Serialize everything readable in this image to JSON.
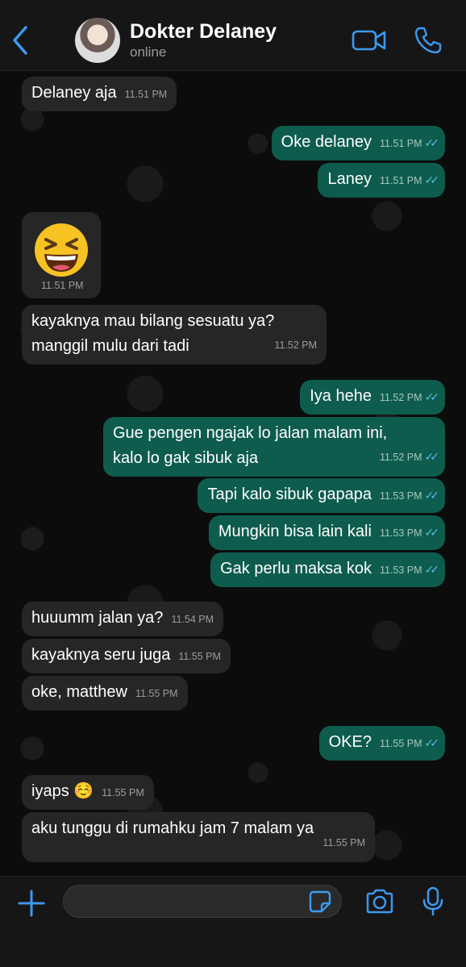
{
  "header": {
    "contact_name": "Dokter Delaney",
    "status": "online"
  },
  "messages": [
    {
      "dir": "in",
      "text": "Delaney aja",
      "time": "11.51 PM"
    },
    {
      "dir": "out",
      "text": "Oke delaney",
      "time": "11.51 PM",
      "read": true
    },
    {
      "dir": "out",
      "text": "Laney",
      "time": "11.51 PM",
      "read": true
    },
    {
      "dir": "in",
      "emoji": "laughing-squint-face",
      "time": "11.51 PM"
    },
    {
      "dir": "in",
      "lines": [
        "kayaknya mau bilang sesuatu ya?",
        "manggil mulu dari tadi"
      ],
      "time": "11.52 PM"
    },
    {
      "dir": "out",
      "text": "Iya hehe",
      "time": "11.52 PM",
      "read": true
    },
    {
      "dir": "out",
      "lines": [
        "Gue pengen ngajak lo jalan malam ini,",
        "kalo lo gak sibuk aja"
      ],
      "time": "11.52 PM",
      "read": true
    },
    {
      "dir": "out",
      "text": "Tapi kalo sibuk gapapa",
      "time": "11.53 PM",
      "read": true
    },
    {
      "dir": "out",
      "text": "Mungkin bisa lain kali",
      "time": "11.53 PM",
      "read": true
    },
    {
      "dir": "out",
      "text": "Gak perlu maksa kok",
      "time": "11.53 PM",
      "read": true
    },
    {
      "dir": "in",
      "text": "huuumm jalan ya?",
      "time": "11.54 PM"
    },
    {
      "dir": "in",
      "text": "kayaknya seru juga",
      "time": "11.55 PM"
    },
    {
      "dir": "in",
      "text": "oke, matthew",
      "time": "11.55 PM"
    },
    {
      "dir": "out",
      "text": "OKE?",
      "time": "11.55 PM",
      "read": true
    },
    {
      "dir": "in",
      "text": "iyaps ☺️",
      "time": "11.55 PM"
    },
    {
      "dir": "in",
      "text": "aku tunggu di rumahku jam 7 malam ya",
      "time": "11.55 PM"
    }
  ],
  "colors": {
    "accent": "#3b9af0",
    "outgoing_bubble": "#0e5c4d",
    "incoming_bubble": "#262626",
    "read_ticks": "#53bdeb"
  },
  "icons": {
    "back": "chevron-left-icon",
    "video": "video-camera-icon",
    "call": "phone-icon",
    "attach": "plus-icon",
    "sticker": "sticker-icon",
    "camera": "camera-icon",
    "mic": "microphone-icon"
  },
  "input": {
    "value": "",
    "placeholder": ""
  }
}
